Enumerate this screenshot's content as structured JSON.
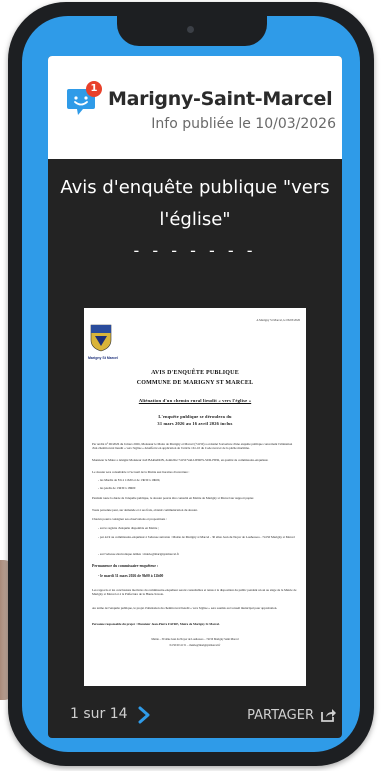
{
  "app": {
    "name": "Marigny-Saint-Marcel",
    "published": "Info publiée le 10/03/2026",
    "notification_count": "1",
    "brand_color": "#2f9be8"
  },
  "post": {
    "title_line1": "Avis d'enquête publique \"vers",
    "title_line2": "l'église\"",
    "dashes": "- - - - - - -"
  },
  "document": {
    "commune": "Marigny St Marcel",
    "date": "A Marigny St Marcel, le 06/03/2026",
    "heading1": "AVIS D'ENQUÊTE PUBLIQUE",
    "heading2": "COMMUNE DE MARIGNY ST MARCEL",
    "subject": "Aliénation d'un chemin rural lieudit « vers l'église »",
    "dates_title": "L'enquête publique se déroulera du",
    "dates": "31 mars 2026 au 16 avril 2026 inclus",
    "paragraphs": [
      "Par arrêté n° 06/2026 du 6 mars 2026, Monsieur le Maire de Marigny et Marcel (74150) a ordonné l'ouverture d'une enquête publique concernant l'aliénation d'un chemin rural lieudit « vers l'église » désaffecté en application de l'article 161-10 du Code rural et de la pêche maritime.",
      "Monsieur le Maire a désigné Monsieur Joël BARADON, domicilié 74150 VALLIERES-SUR-FIER, en qualité de commissaire-enquêteur.",
      "Le dossier sera consultable à l'accueil de la Mairie aux horaires d'ouverture :",
      "- les Mardis de 8 h à 11h30 et de 13h30 à 19h00,",
      "- les jeudis de 13h30 à 18h00",
      "Pendant toute la durée de l'enquête publique, le dossier pourra être consulté en Mairie de Marigny st Marcel sur support papier.",
      "Toute personne peut, sur demande et à ses frais, obtenir communication du dossier.",
      "Chacun pourra consigner ses observations et propositions :",
      "- sur le registre d'enquête disponible en Mairie ;",
      "- par écrit au commissaire-enquêteur à l'adresse suivante : Mairie de Marigny st Marcel - 30 allée Jean du Noyer de Louhossoa - 74150 Marigny st Marcel",
      "- sur l'adresse électronique dédiée : mairie@marignystmarcel.fr"
    ],
    "permanence_title": "Permanence du commissaire-enquêteur :",
    "permanence": "- le mardi 31 mars 2026 de 9h00 à 12h00",
    "closing_paragraphs": [
      "Les rapports et les conclusions motivées du commissaire-enquêteur seront consultables et tenus à la disposition du public pendant un an au siège de la Mairie de Marigny st Marcel et à la Préfecture de la Haute-Savoie.",
      "Au terme de l'enquête publique, le projet d'aliénation du chemin rural lieudit « vers l'église » sera soumis au Conseil municipal pour approbation."
    ],
    "responsible": "Personne responsable du projet : Monsieur Jean-Pierre FAVRE, Maire de Marigny St Marcel.",
    "footer_line1": "Mairie – 30 allée Jean du Noyer de Louhossoa – 74150 Marigny Saint Marcel",
    "footer_line2": "04 50 60 41 51 – mairie@marignystmarcel.fr"
  },
  "footer": {
    "page_indicator": "1 sur 14",
    "next_icon": "chevron-right-icon",
    "share_label": "PARTAGER",
    "share_icon": "share-icon"
  }
}
